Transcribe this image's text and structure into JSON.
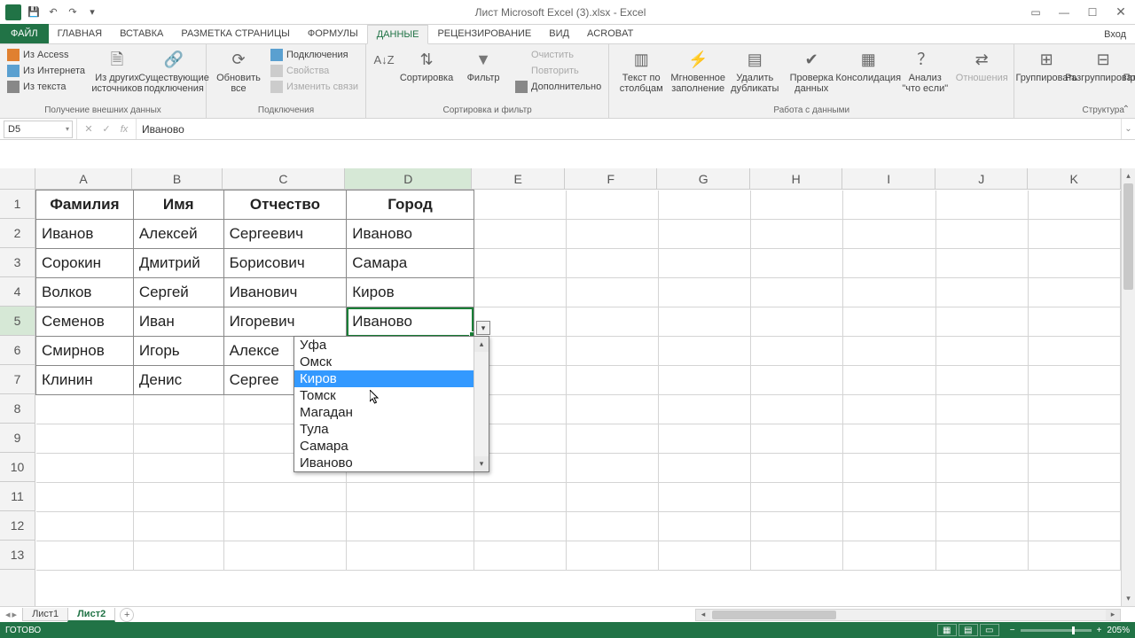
{
  "titlebar": {
    "title": "Лист Microsoft Excel (3).xlsx - Excel"
  },
  "ribbon_tabs": {
    "file": "ФАЙЛ",
    "tabs": [
      "ГЛАВНАЯ",
      "ВСТАВКА",
      "РАЗМЕТКА СТРАНИЦЫ",
      "ФОРМУЛЫ",
      "ДАННЫЕ",
      "РЕЦЕНЗИРОВАНИЕ",
      "ВИД",
      "ACROBAT"
    ],
    "active_index": 4,
    "signin": "Вход"
  },
  "ribbon": {
    "group_external": {
      "label": "Получение внешних данных",
      "access": "Из Access",
      "web": "Из Интернета",
      "text": "Из текста",
      "other": "Из других источников",
      "existing": "Существующие подключения"
    },
    "group_conn": {
      "label": "Подключения",
      "refresh": "Обновить все",
      "connections": "Подключения",
      "properties": "Свойства",
      "editlinks": "Изменить связи"
    },
    "group_sort": {
      "label": "Сортировка и фильтр",
      "sort": "Сортировка",
      "filter": "Фильтр",
      "clear": "Очистить",
      "reapply": "Повторить",
      "advanced": "Дополнительно"
    },
    "group_tools": {
      "label": "Работа с данными",
      "texttocol": "Текст по столбцам",
      "flash": "Мгновенное заполнение",
      "dedup": "Удалить дубликаты",
      "validation": "Проверка данных",
      "consolidate": "Консолидация",
      "whatif": "Анализ \"что если\"",
      "relations": "Отношения"
    },
    "group_outline": {
      "label": "Структура",
      "group": "Группировать",
      "ungroup": "Разгруппировать",
      "subtotal": "Промежуточный итог"
    }
  },
  "formula_bar": {
    "cellref": "D5",
    "value": "Иваново"
  },
  "columns": {
    "A": "A",
    "B": "B",
    "C": "C",
    "D": "D",
    "E": "E",
    "F": "F",
    "G": "G",
    "H": "H",
    "I": "I",
    "J": "J",
    "K": "K"
  },
  "headers": {
    "A": "Фамилия",
    "B": "Имя",
    "C": "Отчество",
    "D": "Город"
  },
  "rows": [
    {
      "A": "Иванов",
      "B": "Алексей",
      "C": "Сергеевич",
      "D": "Иваново"
    },
    {
      "A": "Сорокин",
      "B": "Дмитрий",
      "C": "Борисович",
      "D": "Самара"
    },
    {
      "A": "Волков",
      "B": "Сергей",
      "C": "Иванович",
      "D": "Киров"
    },
    {
      "A": "Семенов",
      "B": "Иван",
      "C": "Игоревич",
      "D": "Иваново"
    },
    {
      "A": "Смирнов",
      "B": "Игорь",
      "C": "Алексе",
      "D": ""
    },
    {
      "A": "Клинин",
      "B": "Денис",
      "C": "Сергее",
      "D": ""
    }
  ],
  "dropdown": {
    "items": [
      "Уфа",
      "Омск",
      "Киров",
      "Томск",
      "Магадан",
      "Тула",
      "Самара",
      "Иваново"
    ],
    "highlighted_index": 2
  },
  "sheets": {
    "tabs": [
      "Лист1",
      "Лист2"
    ],
    "active_index": 1
  },
  "status": {
    "ready": "ГОТОВО",
    "zoom": "205%"
  }
}
